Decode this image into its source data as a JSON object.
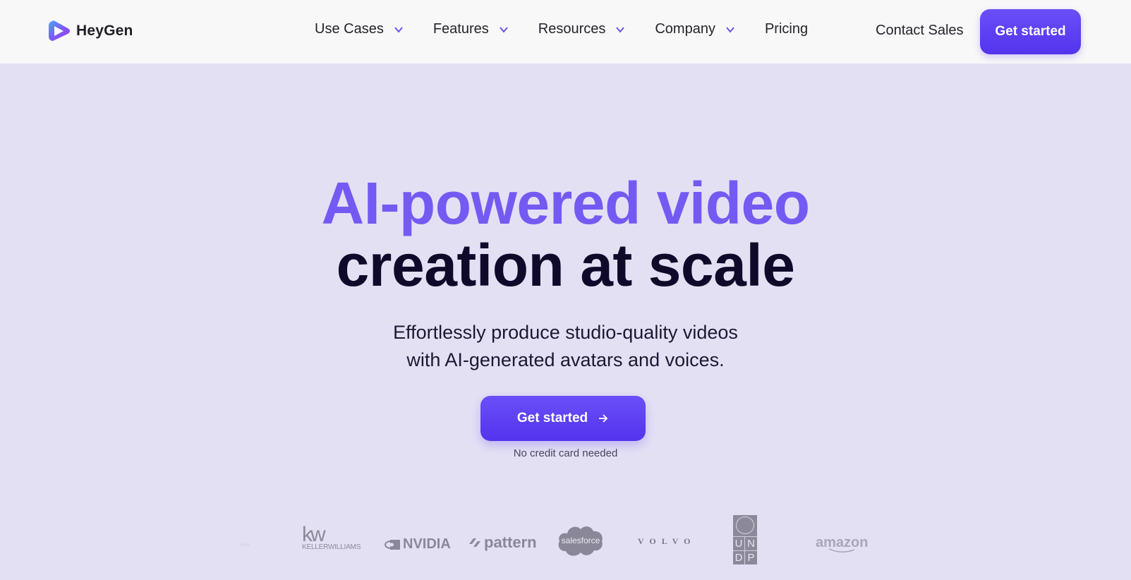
{
  "header": {
    "brand": "HeyGen",
    "nav": [
      {
        "label": "Use Cases",
        "has_dropdown": true
      },
      {
        "label": "Features",
        "has_dropdown": true
      },
      {
        "label": "Resources",
        "has_dropdown": true
      },
      {
        "label": "Company",
        "has_dropdown": true
      },
      {
        "label": "Pricing",
        "has_dropdown": false
      }
    ],
    "contact_sales": "Contact Sales",
    "get_started": "Get started"
  },
  "hero": {
    "title_line1": "AI-powered video",
    "title_line2": "creation at scale",
    "subtitle_line1": "Effortlessly produce studio-quality videos",
    "subtitle_line2": "with AI-generated avatars and voices.",
    "cta_label": "Get started",
    "cta_note": "No credit card needed"
  },
  "logos": {
    "keller_williams": {
      "mark": "kw",
      "name": "KELLERWILLIAMS"
    },
    "nvidia": "NVIDIA",
    "pattern": "pattern",
    "salesforce": "salesforce",
    "volvo": "VOLVO",
    "undp": [
      "U",
      "N",
      "D",
      "P"
    ],
    "amazon": "amazon"
  },
  "colors": {
    "accent": "#5b3cf0",
    "headline_accent": "#7559f3",
    "headline_dark": "#0f0a2a",
    "hero_bg": "#e4e0f4",
    "header_bg": "#f8f8f9"
  }
}
